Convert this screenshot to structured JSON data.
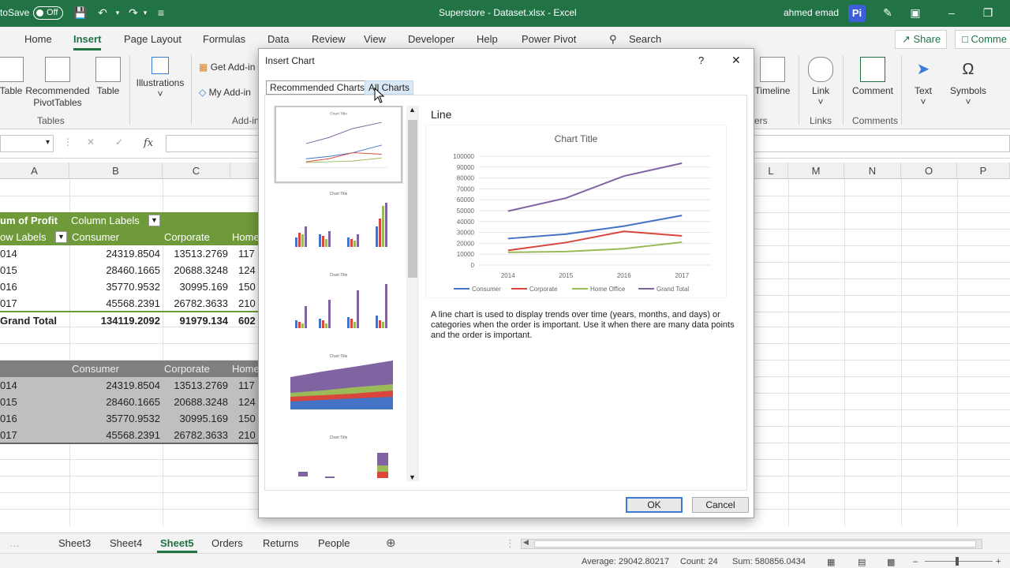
{
  "titlebar": {
    "autosave_label": "toSave",
    "autosave_state": "Off",
    "document_title": "Superstore - Dataset.xlsx  -  Excel",
    "user_name": "ahmed emad",
    "user_initials": "Pi"
  },
  "ribbon_tabs": [
    "Home",
    "Insert",
    "Page Layout",
    "Formulas",
    "Data",
    "Review",
    "View",
    "Developer",
    "Help",
    "Power Pivot"
  ],
  "search_label": "Search",
  "share_label": "Share",
  "comments_label": "Comme",
  "ribbon": {
    "left_buttons": [
      "Table",
      "Recommended\nPivotTables",
      "Table"
    ],
    "illustrations": "Illustrations",
    "get_addins": "Get Add-in",
    "my_addins": "My Add-in",
    "timeline": "Timeline",
    "link": "Link",
    "comment": "Comment",
    "text": "Text",
    "symbols": "Symbols",
    "groups": {
      "tables": "Tables",
      "addins": "Add-in",
      "filters": "ers",
      "links": "Links",
      "comments": "Comments"
    }
  },
  "formula_bar": {
    "fx": "fx"
  },
  "columns": [
    "A",
    "B",
    "C",
    "L",
    "M",
    "N",
    "O",
    "P"
  ],
  "pivot": {
    "header_field": "um of Profit",
    "column_labels": "Column Labels",
    "row_labels": "ow Labels",
    "col_names": [
      "Consumer",
      "Corporate",
      "Home"
    ],
    "rows": [
      [
        "014",
        "24319.8504",
        "13513.2769",
        "117"
      ],
      [
        "015",
        "28460.1665",
        "20688.3248",
        "124"
      ],
      [
        "016",
        "35770.9532",
        "30995.169",
        "150"
      ],
      [
        "017",
        "45568.2391",
        "26782.3633",
        "210"
      ]
    ],
    "grand_total": [
      "Grand Total",
      "134119.2092",
      "91979.134",
      "602"
    ]
  },
  "copy_table": {
    "col_names": [
      "Consumer",
      "Corporate",
      "Home"
    ],
    "rows": [
      [
        "014",
        "24319.8504",
        "13513.2769",
        "117"
      ],
      [
        "015",
        "28460.1665",
        "20688.3248",
        "124"
      ],
      [
        "016",
        "35770.9532",
        "30995.169",
        "150"
      ],
      [
        "017",
        "45568.2391",
        "26782.3633",
        "210"
      ]
    ]
  },
  "dialog": {
    "title": "Insert Chart",
    "help": "?",
    "close": "✕",
    "tabs": [
      "Recommended Charts",
      "All Charts"
    ],
    "chart_type_name": "Line",
    "description": "A line chart is used to display trends over time (years, months, and days) or categories when the order is important. Use it when there are many data points and the order is important.",
    "ok": "OK",
    "cancel": "Cancel",
    "thumb_title": "Chart Title"
  },
  "chart_data": {
    "type": "line",
    "title": "Chart Title",
    "categories": [
      "2014",
      "2015",
      "2016",
      "2017"
    ],
    "ylim": [
      0,
      100000
    ],
    "yticks": [
      0,
      10000,
      20000,
      30000,
      40000,
      50000,
      60000,
      70000,
      80000,
      90000,
      100000
    ],
    "legend_position": "bottom",
    "grid": true,
    "series": [
      {
        "name": "Consumer",
        "color": "#4472c4",
        "values": [
          24319.85,
          28460.17,
          35770.95,
          45568.24
        ]
      },
      {
        "name": "Corporate",
        "color": "#d9463c",
        "values": [
          13513.28,
          20688.32,
          30995.17,
          26782.36
        ]
      },
      {
        "name": "Home Office",
        "color": "#9bbb59",
        "values": [
          11700,
          12400,
          15000,
          21000
        ]
      },
      {
        "name": "Grand Total",
        "color": "#8064a2",
        "values": [
          49533.13,
          61548.49,
          81766.12,
          93551.6
        ]
      }
    ]
  },
  "sheet_tabs": [
    "Sheet3",
    "Sheet4",
    "Sheet5",
    "Orders",
    "Returns",
    "People"
  ],
  "active_sheet": "Sheet5",
  "status": {
    "average": "Average: 29042.80217",
    "count": "Count: 24",
    "sum": "Sum: 580856.0434"
  },
  "colors": {
    "excel_green": "#217346",
    "pivot_header": "#6f9a3a",
    "table_header": "#7f7f7f"
  }
}
